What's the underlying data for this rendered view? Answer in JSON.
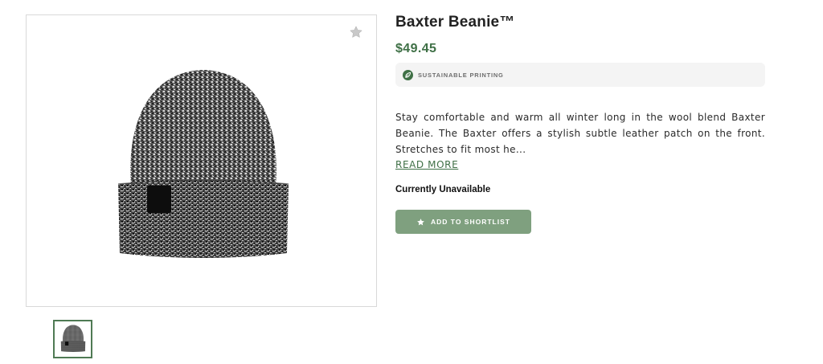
{
  "product": {
    "title": "Baxter Beanie™",
    "price": "$49.45",
    "badge": {
      "icon": "leaf-icon",
      "label": "SUSTAINABLE PRINTING"
    },
    "description": "Stay comfortable and warm all winter long in the wool blend Baxter Beanie. The Baxter offers a stylish subtle leather patch on the front.  Stretches to fit most he...",
    "read_more": "READ MORE",
    "availability": "Currently Unavailable",
    "shortlist_button": {
      "icon": "star-icon",
      "label": "ADD TO SHORTLIST"
    }
  },
  "gallery": {
    "favorite_icon": "star-icon",
    "thumbnail_count": 1
  },
  "colors": {
    "accent_green": "#3f7046",
    "button_green": "#7fa07f",
    "badge_bg": "#f4f4f4"
  }
}
